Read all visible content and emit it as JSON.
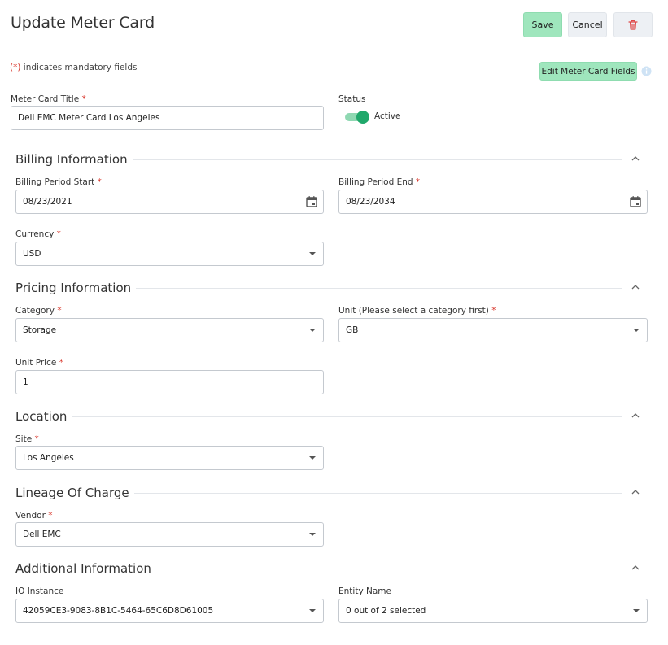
{
  "header": {
    "title": "Update Meter Card",
    "save_label": "Save",
    "cancel_label": "Cancel",
    "delete_icon": "trash-icon"
  },
  "mandatory_note": {
    "marker": "(*)",
    "text": " indicates mandatory fields"
  },
  "edit_fields_label": "Edit Meter Card Fields",
  "required_marker": "*",
  "colors": {
    "accent_green": "#9fe6bd",
    "toggle_on": "#20a86b",
    "required": "#d9362b",
    "delete_red": "#e04848"
  },
  "meter_card_title": {
    "label": "Meter Card Title",
    "value": "Dell EMC Meter Card Los Angeles"
  },
  "status": {
    "label": "Status",
    "value": "Active",
    "on": true
  },
  "billing": {
    "heading": "Billing Information",
    "period_start": {
      "label": "Billing Period Start",
      "value": "08/23/2021"
    },
    "period_end": {
      "label": "Billing Period End",
      "value": "08/23/2034"
    },
    "currency": {
      "label": "Currency",
      "value": "USD"
    }
  },
  "pricing": {
    "heading": "Pricing Information",
    "category": {
      "label": "Category",
      "value": "Storage"
    },
    "unit": {
      "label": "Unit (Please select a category first)",
      "value": "GB"
    },
    "unit_price": {
      "label": "Unit Price",
      "value": "1"
    }
  },
  "location": {
    "heading": "Location",
    "site": {
      "label": "Site",
      "value": "Los Angeles"
    }
  },
  "lineage": {
    "heading": "Lineage Of Charge",
    "vendor": {
      "label": "Vendor",
      "value": "Dell EMC"
    }
  },
  "additional": {
    "heading": "Additional Information",
    "io_instance": {
      "label": "IO Instance",
      "value": "42059CE3-9083-8B1C-5464-65C6D8D61005"
    },
    "entity_name": {
      "label": "Entity Name",
      "value": "0 out of 2 selected"
    }
  }
}
